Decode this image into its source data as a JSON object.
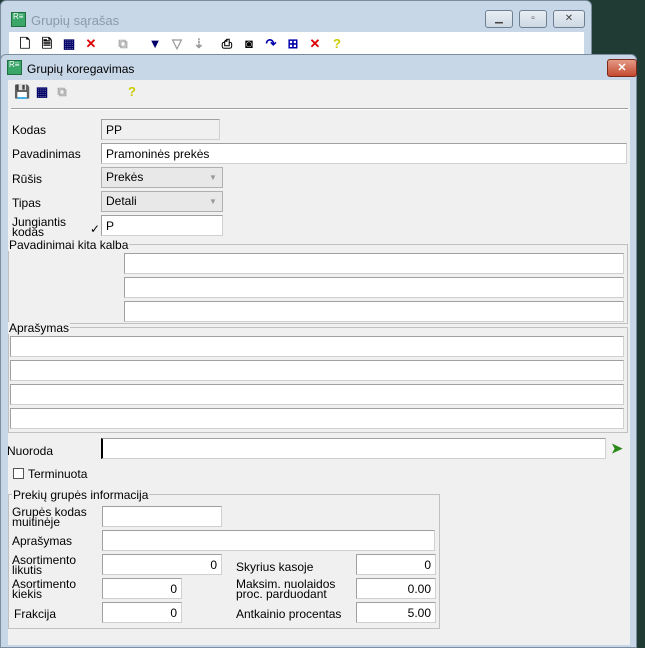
{
  "back_window": {
    "title": "Grupių sąrašas",
    "toolbar": [
      "new-icon",
      "document-icon",
      "view-icon",
      "delete-icon",
      "copy-icon",
      "filter-select-icon",
      "filter-icon",
      "sort-icon",
      "print-icon",
      "binoculars-icon",
      "refresh-icon",
      "tree-icon",
      "clear-icon",
      "help-icon"
    ]
  },
  "dialog": {
    "title": "Grupių koregavimas",
    "fields": {
      "kodas": {
        "label": "Kodas",
        "value": "PP"
      },
      "pavadinimas": {
        "label": "Pavadinimas",
        "value": "Pramoninės prekės"
      },
      "rusis": {
        "label": "Rūšis",
        "value": "Prekės"
      },
      "tipas": {
        "label": "Tipas",
        "value": "Detali"
      },
      "jungiantis": {
        "label1": "Jungiantis",
        "label2": "kodas",
        "mark": "✓",
        "value": "P"
      },
      "kita_kalba": {
        "label": "Pavadinimai kita kalba"
      },
      "aprasymas": {
        "label": "Aprašymas"
      },
      "nuoroda": {
        "label": "Nuoroda",
        "value": ""
      },
      "terminuota": {
        "label": "Terminuota",
        "checked": false
      }
    },
    "info": {
      "label": "Prekių grupės informacija",
      "muitineje": {
        "label1": "Grupės kodas",
        "label2": "muitinėje",
        "value": ""
      },
      "aprasymas": {
        "label": "Aprašymas",
        "value": ""
      },
      "likutis": {
        "label1": "Asortimento",
        "label2": "likutis",
        "value": "0"
      },
      "kiekis": {
        "label1": "Asortimento",
        "label2": "kiekis",
        "value": "0"
      },
      "frakcija": {
        "label": "Frakcija",
        "value": "0"
      },
      "skyrius": {
        "label": "Skyrius kasoje",
        "value": "0"
      },
      "nuolaida": {
        "label1": "Maksim. nuolaidos",
        "label2": "proc. parduodant",
        "value": "0.00"
      },
      "antkainis": {
        "label": "Antkainio procentas",
        "value": "5.00"
      }
    }
  }
}
